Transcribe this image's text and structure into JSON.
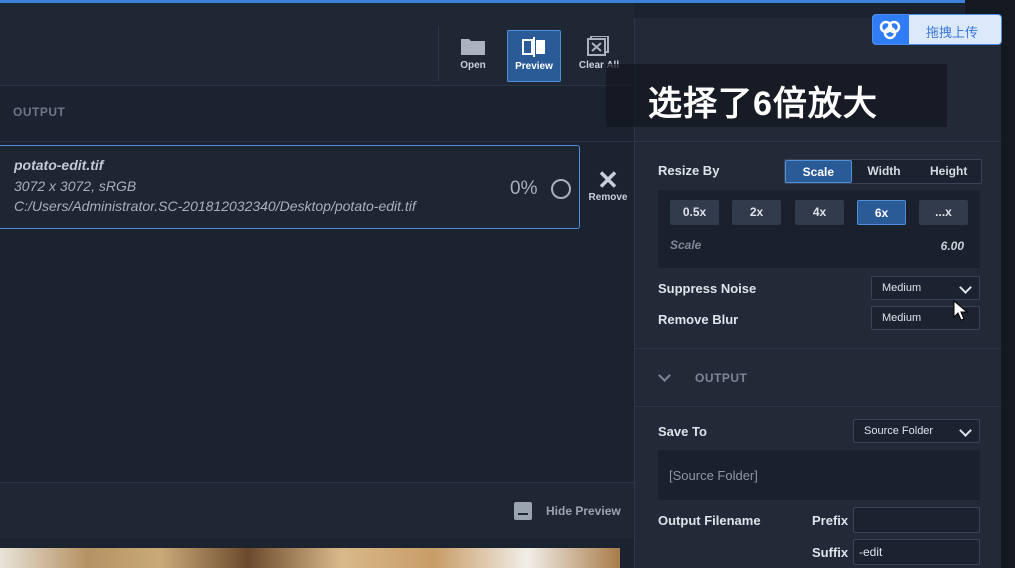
{
  "toolbar": {
    "open_label": "Open",
    "preview_label": "Preview",
    "clear_all_label": "Clear All"
  },
  "left": {
    "section_title": "OUTPUT",
    "file": {
      "name": "potato-edit.tif",
      "dims": "3072 x 3072, sRGB",
      "path": "C:/Users/Administrator.SC-201812032340/Desktop/potato-edit.tif",
      "progress": "0%"
    },
    "remove_label": "Remove",
    "hide_preview_label": "Hide Preview"
  },
  "right": {
    "resize_by_label": "Resize By",
    "resize_modes": [
      "Scale",
      "Width",
      "Height"
    ],
    "active_mode": "Scale",
    "scale_buttons": [
      "0.5x",
      "2x",
      "4x",
      "6x",
      "...x"
    ],
    "active_scale": "6x",
    "scale_label": "Scale",
    "scale_value": "6.00",
    "suppress_noise_label": "Suppress Noise",
    "suppress_noise_value": "Medium",
    "remove_blur_label": "Remove Blur",
    "remove_blur_value": "Medium",
    "output_section": "OUTPUT",
    "save_to_label": "Save To",
    "save_to_value": "Source Folder",
    "save_to_path": "[Source Folder]",
    "output_filename_label": "Output Filename",
    "prefix_label": "Prefix",
    "prefix_value": "",
    "suffix_label": "Suffix",
    "suffix_value": "-edit"
  },
  "overlay_caption": "选择了6倍放大",
  "upload_button_label": "拖拽上传",
  "colors": {
    "accent": "#2a5b97",
    "accent_border": "#4f8fd8",
    "background": "#1b2230",
    "panel": "#222a38"
  }
}
